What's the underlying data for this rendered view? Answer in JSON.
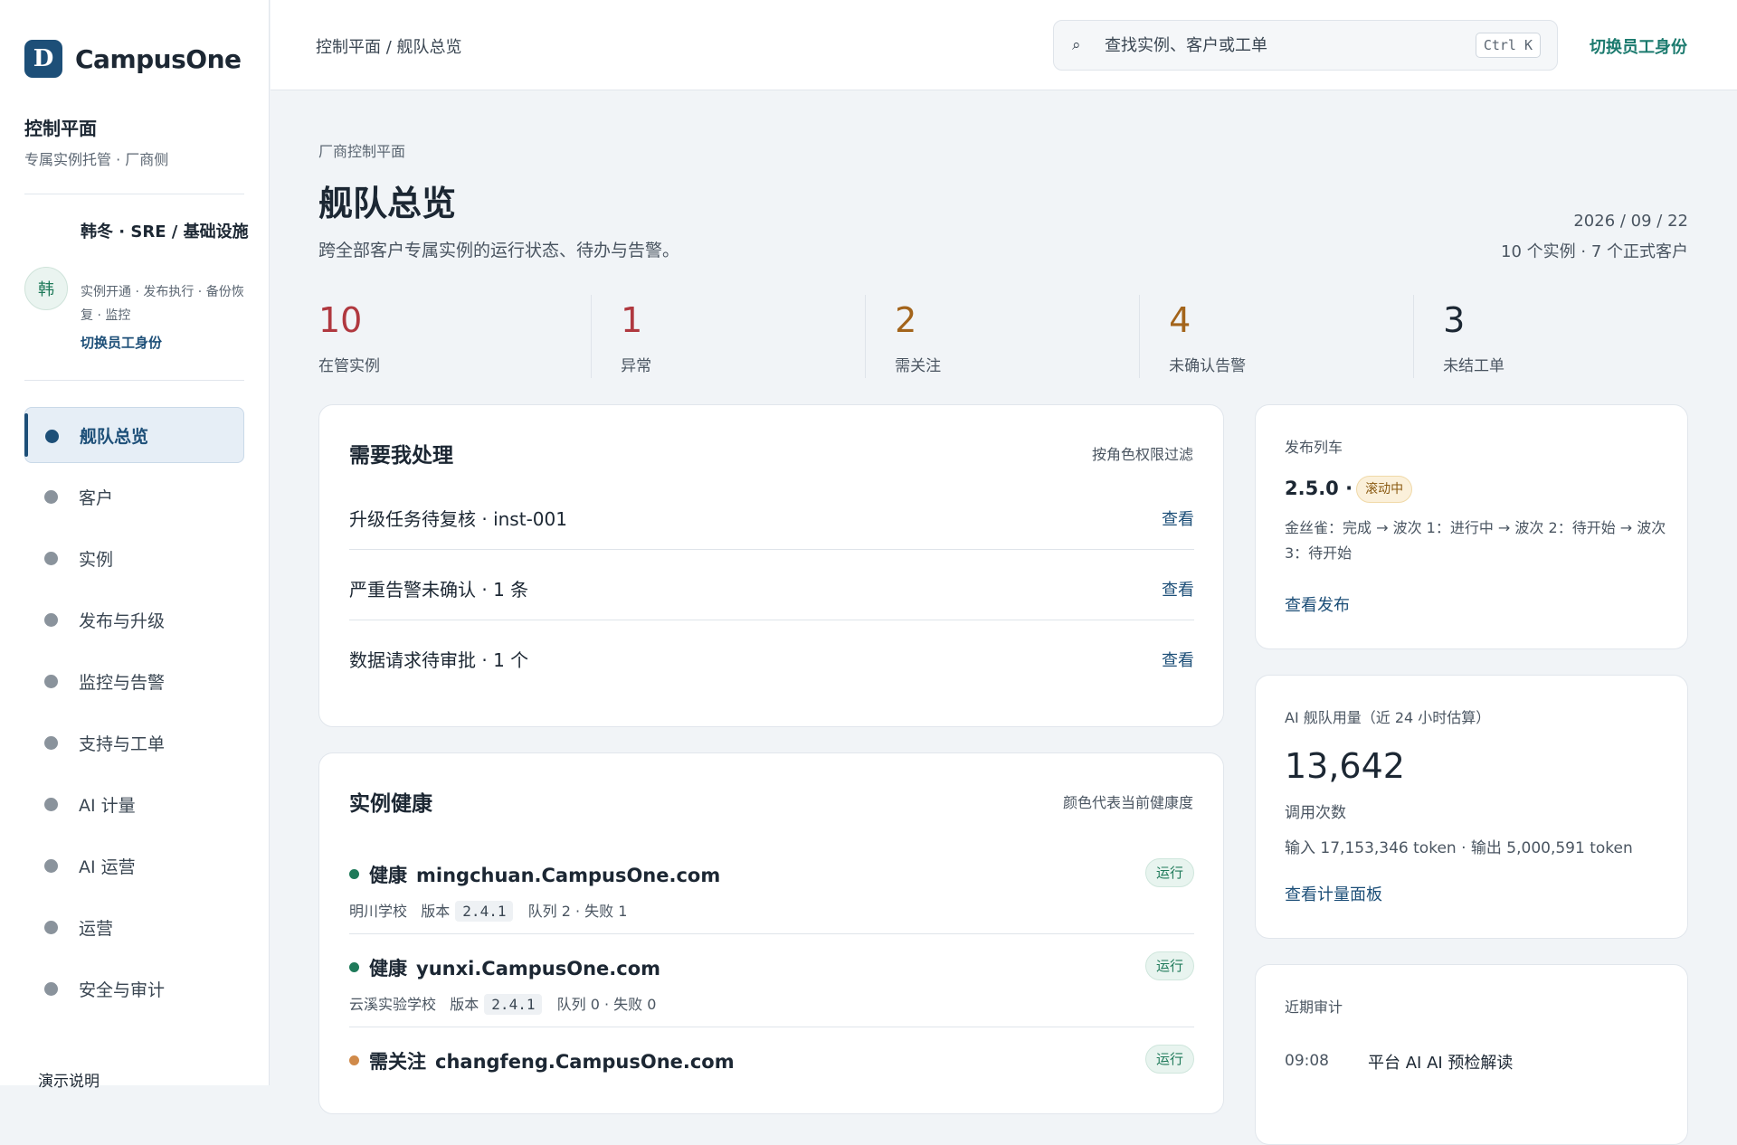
{
  "brand": {
    "logo_letter": "D",
    "name": "CampusOne"
  },
  "sidebar": {
    "title": "控制平面",
    "subtitle": "专属实例托管 · 厂商侧",
    "user": {
      "avatar": "韩",
      "name": "韩冬 · SRE / 基础设施",
      "roles": "实例开通 · 发布执行 · 备份恢复 · 监控",
      "switch_label": "切换员工身份"
    },
    "nav": [
      {
        "label": "舰队总览",
        "active": true
      },
      {
        "label": "客户"
      },
      {
        "label": "实例"
      },
      {
        "label": "发布与升级"
      },
      {
        "label": "监控与告警"
      },
      {
        "label": "支持与工单"
      },
      {
        "label": "AI 计量"
      },
      {
        "label": "AI 运营"
      },
      {
        "label": "运营"
      },
      {
        "label": "安全与审计"
      }
    ],
    "demo_note": "演示说明"
  },
  "topbar": {
    "breadcrumb": "控制平面 / 舰队总览",
    "search_placeholder": "查找实例、客户或工单",
    "search_shortcut": "Ctrl K",
    "switch_label": "切换员工身份"
  },
  "page": {
    "eyebrow": "厂商控制平面",
    "title": "舰队总览",
    "subtitle": "跨全部客户专属实例的运行状态、待办与告警。",
    "date": "2026 / 09 / 22",
    "counts": "10 个实例 · 7 个正式客户"
  },
  "stats": [
    {
      "value": "10",
      "label": "在管实例",
      "color": "#b0383f"
    },
    {
      "value": "1",
      "label": "异常",
      "color": "#b0383f"
    },
    {
      "value": "2",
      "label": "需关注",
      "color": "#a3641b"
    },
    {
      "value": "4",
      "label": "未确认告警",
      "color": "#a3641b"
    },
    {
      "value": "3",
      "label": "未结工单",
      "color": "#1c2733"
    }
  ],
  "todo": {
    "title": "需要我处理",
    "hint": "按角色权限过滤",
    "items": [
      {
        "text": "升级任务待复核 · inst-001",
        "link": "查看"
      },
      {
        "text": "严重告警未确认 · 1 条",
        "link": "查看"
      },
      {
        "text": "数据请求待审批 · 1 个",
        "link": "查看"
      }
    ]
  },
  "health": {
    "title": "实例健康",
    "hint": "颜色代表当前健康度",
    "rows": [
      {
        "status": "健康",
        "status_color": "#1f7a5a",
        "host": "mingchuan.CampusOne.com",
        "school": "明川学校",
        "version_label": "版本",
        "version": "2.4.1",
        "queue": "队列 2 · 失败 1",
        "state": "运行"
      },
      {
        "status": "健康",
        "status_color": "#1f7a5a",
        "host": "yunxi.CampusOne.com",
        "school": "云溪实验学校",
        "version_label": "版本",
        "version": "2.4.1",
        "queue": "队列 0 · 失败 0",
        "state": "运行"
      },
      {
        "status": "需关注",
        "status_color": "#d08a4a",
        "host": "changfeng.CampusOne.com",
        "school": "",
        "version_label": "",
        "version": "",
        "queue": "",
        "state": "运行"
      }
    ]
  },
  "release": {
    "label": "发布列车",
    "version": "2.5.0 ·",
    "badge": "滚动中",
    "waves": "金丝雀：完成 → 波次 1：进行中 → 波次 2：待开始 → 波次 3：待开始",
    "link": "查看发布"
  },
  "ai": {
    "label": "AI 舰队用量（近 24 小时估算）",
    "value": "13,642",
    "unit": "调用次数",
    "tokens": "输入 17,153,346 token · 输出 5,000,591 token",
    "link": "查看计量面板"
  },
  "audit": {
    "label": "近期审计",
    "time": "09:08",
    "text": "平台 AI AI 预检解读"
  }
}
